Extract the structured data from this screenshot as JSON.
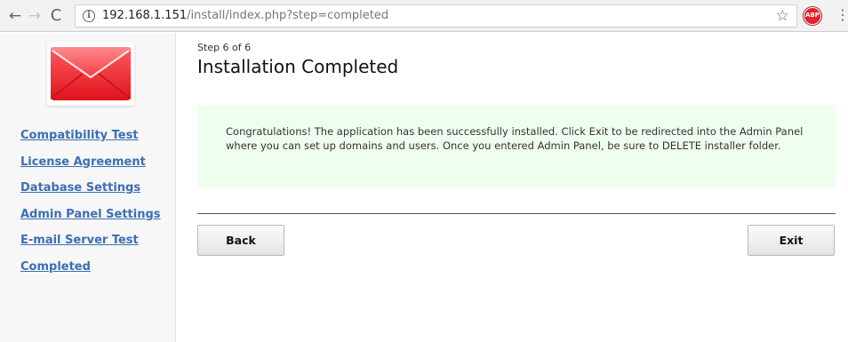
{
  "browser": {
    "nav_back": "←",
    "nav_forward": "→",
    "nav_reload": "C",
    "info_icon": "i",
    "url_host": "192.168.1.151",
    "url_path": "/install/index.php?step=completed",
    "star_icon": "☆",
    "extension_label": "ABP",
    "menu_icon": "⋮",
    "colors": {
      "toolbar": "#f2f2f2",
      "extension": "#e0232c"
    }
  },
  "sidebar": {
    "logo_icon": "envelope-icon",
    "items": [
      {
        "label": "Compatibility Test"
      },
      {
        "label": "License Agreement"
      },
      {
        "label": "Database Settings"
      },
      {
        "label": "Admin Panel Settings"
      },
      {
        "label": "E-mail Server Test"
      },
      {
        "label": "Completed"
      }
    ],
    "link_color": "#3c6eb4"
  },
  "main": {
    "step": "Step 6 of 6",
    "title": "Installation Completed",
    "message": "Congratulations! The application has been successfully installed. Click Exit to be redirected into the Admin Panel where you can set up domains and users. Once you entered Admin Panel, be sure to DELETE installer folder.",
    "message_bg": "#efffef",
    "back_label": "Back",
    "exit_label": "Exit"
  }
}
